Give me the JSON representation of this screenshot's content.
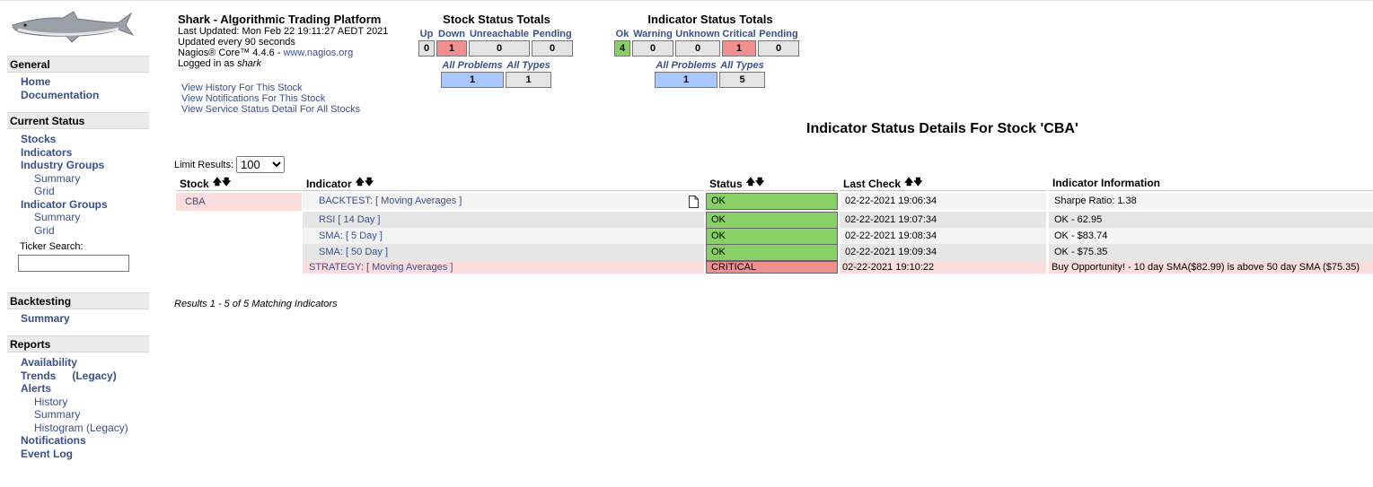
{
  "header": {
    "title": "Shark - Algorithmic Trading Platform",
    "last_updated": "Last Updated: Mon Feb 22 19:11:27 AEDT 2021",
    "update_interval": "Updated every 90 seconds",
    "core_prefix": "Nagios® Core™ 4.4.6 - ",
    "core_link": "www.nagios.org",
    "logged_in_prefix": "Logged in as ",
    "user": "shark"
  },
  "links": [
    "View History For This Stock",
    "View Notifications For This Stock",
    "View Service Status Detail For All Stocks"
  ],
  "sidebar": {
    "general": {
      "title": "General",
      "items": [
        "Home",
        "Documentation"
      ]
    },
    "current_status": {
      "title": "Current Status",
      "stocks": "Stocks",
      "indicators": "Indicators",
      "industry_groups": "Industry Groups",
      "industry_summary": "Summary",
      "industry_grid": "Grid",
      "indicator_groups": "Indicator Groups",
      "indicator_summary": "Summary",
      "indicator_grid": "Grid",
      "ticker_search_label": "Ticker Search:",
      "ticker_search_value": ""
    },
    "backtesting": {
      "title": "Backtesting",
      "summary": "Summary"
    },
    "reports": {
      "title": "Reports",
      "availability": "Availability",
      "trends": "Trends",
      "trends_legacy": "(Legacy)",
      "alerts": "Alerts",
      "alerts_history": "History",
      "alerts_summary": "Summary",
      "alerts_histogram": "Histogram (Legacy)",
      "notifications": "Notifications",
      "event_log": "Event Log"
    }
  },
  "stock_totals": {
    "title": "Stock Status Totals",
    "labels": [
      "Up",
      "Down",
      "Unreachable",
      "Pending"
    ],
    "values": [
      "0",
      "1",
      "0",
      "0"
    ],
    "all_problems_label": "All Problems",
    "all_types_label": "All Types",
    "all_problems": "1",
    "all_types": "1"
  },
  "indicator_totals": {
    "title": "Indicator Status Totals",
    "labels": [
      "Ok",
      "Warning",
      "Unknown",
      "Critical",
      "Pending"
    ],
    "values": [
      "4",
      "0",
      "0",
      "1",
      "0"
    ],
    "all_problems_label": "All Problems",
    "all_types_label": "All Types",
    "all_problems": "1",
    "all_types": "5"
  },
  "page_title": "Indicator Status Details For Stock 'CBA'",
  "limit": {
    "label": "Limit Results:",
    "value": "100"
  },
  "table": {
    "headers": [
      "Stock",
      "Indicator",
      "Status",
      "Last Check",
      "Indicator Information"
    ],
    "stock": "CBA",
    "rows": [
      {
        "indicator": "BACKTEST: [ Moving Averages ]",
        "status": "OK",
        "last_check": "02-22-2021 19:06:34",
        "info": "Sharpe Ratio: 1.38"
      },
      {
        "indicator": "RSI [ 14 Day ]",
        "status": "OK",
        "last_check": "02-22-2021 19:07:34",
        "info": "OK - 62.95"
      },
      {
        "indicator": "SMA: [ 5 Day ]",
        "status": "OK",
        "last_check": "02-22-2021 19:08:34",
        "info": "OK - $83.74"
      },
      {
        "indicator": "SMA: [ 50 Day ]",
        "status": "OK",
        "last_check": "02-22-2021 19:09:34",
        "info": "OK - $75.35"
      },
      {
        "indicator": "STRATEGY: [ Moving Averages ]",
        "status": "CRITICAL",
        "last_check": "02-22-2021 19:10:22",
        "info": "Buy Opportunity! - 10 day SMA($82.99) is above 50 day SMA ($75.35)"
      }
    ]
  },
  "results": "Results 1 - 5 of 5 Matching Indicators",
  "colors": {
    "ok": "#88d066",
    "critical": "#f08f8f",
    "link": "#3b4f8c",
    "problems": "#a8c8ff"
  }
}
